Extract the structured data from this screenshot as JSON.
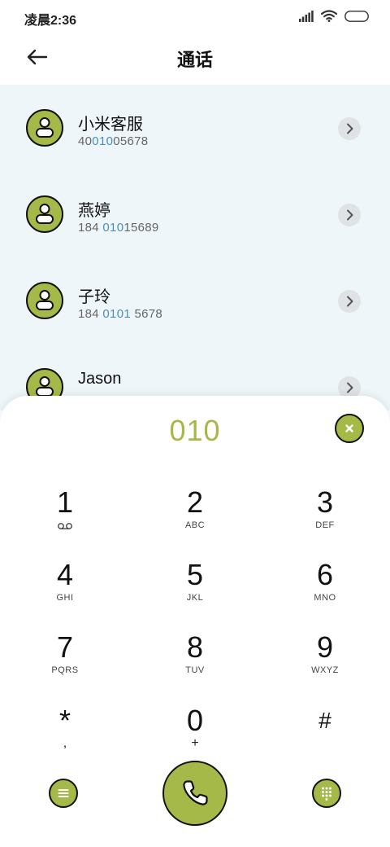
{
  "status_bar": {
    "time": "凌晨2:36"
  },
  "header": {
    "title": "通话"
  },
  "contacts": [
    {
      "name": "小米客服",
      "number_pre": "40",
      "number_match": "010",
      "number_post": "05678"
    },
    {
      "name": "燕婷",
      "number_pre": "184 ",
      "number_match": "010",
      "number_post": "15689"
    },
    {
      "name": "子玲",
      "number_pre": "184 ",
      "number_match": "0101",
      "number_post": " 5678"
    },
    {
      "name": "Jason",
      "number_pre": "",
      "number_match": "",
      "number_post": ""
    }
  ],
  "dialpad": {
    "dialed": "010",
    "keys": [
      {
        "digit": "1",
        "letters": ""
      },
      {
        "digit": "2",
        "letters": "ABC"
      },
      {
        "digit": "3",
        "letters": "DEF"
      },
      {
        "digit": "4",
        "letters": "GHI"
      },
      {
        "digit": "5",
        "letters": "JKL"
      },
      {
        "digit": "6",
        "letters": "MNO"
      },
      {
        "digit": "7",
        "letters": "PQRS"
      },
      {
        "digit": "8",
        "letters": "TUV"
      },
      {
        "digit": "9",
        "letters": "WXYZ"
      },
      {
        "digit": "*",
        "letters": ","
      },
      {
        "digit": "0",
        "letters": "+"
      },
      {
        "digit": "#",
        "letters": ""
      }
    ]
  },
  "colors": {
    "accent": "#a4b948",
    "match": "#4a8fb8",
    "list_bg": "#eef6f9"
  },
  "icons": {
    "voicemail": "voicemail-icon",
    "menu": "menu-icon",
    "call": "phone-icon",
    "keypad": "keypad-icon",
    "clear": "close-icon",
    "back": "back-arrow-icon",
    "avatar": "person-icon",
    "chevron": "chevron-right-icon"
  }
}
